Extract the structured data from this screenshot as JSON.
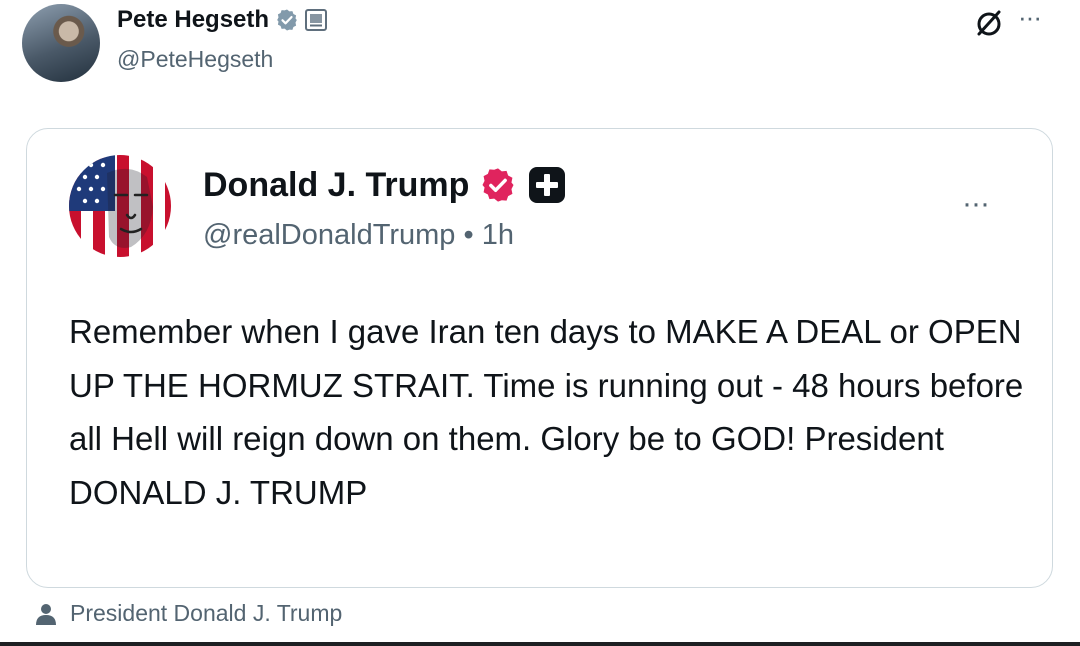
{
  "outer_post": {
    "author_name": "Pete Hegseth",
    "author_handle": "@PeteHegseth",
    "more_label": "···"
  },
  "quoted_post": {
    "author_name": "Donald J. Trump",
    "author_handle": "@realDonaldTrump",
    "separator": "•",
    "timestamp": "1h",
    "more_label": "···",
    "text": "Remember when I gave Iran ten days to MAKE A DEAL or OPEN UP THE HORMUZ STRAIT. Time is running out - 48 hours before all Hell will reign down on them. Glory be to GOD! President DONALD J. TRUMP"
  },
  "attribution": {
    "label": "President Donald J. Trump"
  },
  "icons": {
    "outer_verified": "verified-badge-icon",
    "outer_affiliation": "government-affiliation-icon",
    "grok": "grok-icon",
    "inner_verified": "verified-badge-icon",
    "inner_affiliate": "plus-badge-icon",
    "person": "person-icon"
  },
  "colors": {
    "text_primary": "#0f1419",
    "text_secondary": "#536471",
    "verified_gray": "#829aab",
    "verified_pink": "#e0245e",
    "border": "#cfd9de"
  }
}
